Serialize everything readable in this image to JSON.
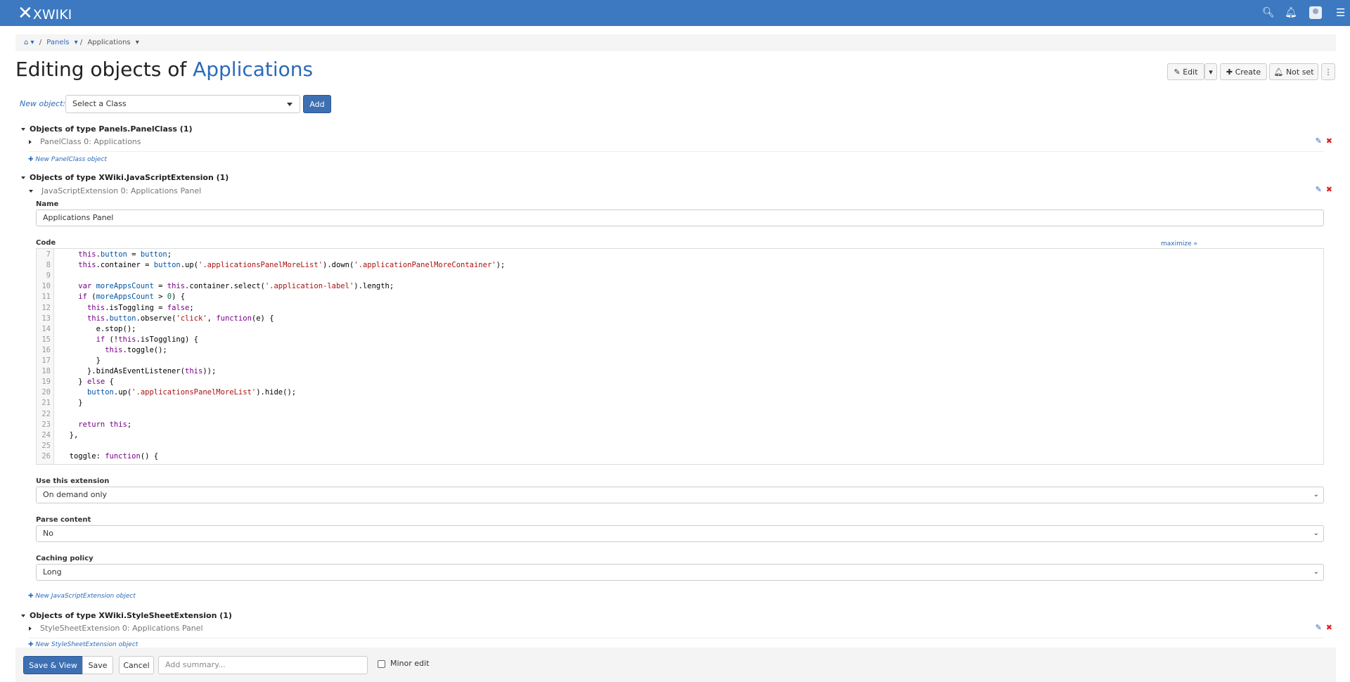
{
  "app": {
    "logo": "XWIKI"
  },
  "breadcrumb": {
    "items": [
      "Panels",
      "Applications"
    ]
  },
  "page": {
    "title_prefix": "Editing objects of",
    "title_link": "Applications"
  },
  "actions": {
    "edit": "Edit",
    "create": "Create",
    "notify": "Not set"
  },
  "new_object": {
    "label": "New object:",
    "placeholder": "Select a Class",
    "add": "Add"
  },
  "sections": [
    {
      "title": "Objects of type Panels.PanelClass (1)",
      "object": "PanelClass 0: Applications",
      "new_link": "New PanelClass object"
    },
    {
      "title": "Objects of type XWiki.JavaScriptExtension (1)",
      "object": "JavaScriptExtension 0: Applications Panel",
      "new_link": "New JavaScriptExtension object"
    },
    {
      "title": "Objects of type XWiki.StyleSheetExtension (1)",
      "object": "StyleSheetExtension 0: Applications Panel",
      "new_link": "New StyleSheetExtension object"
    }
  ],
  "form": {
    "name_label": "Name",
    "name_value": "Applications Panel",
    "code_label": "Code",
    "maximize": "maximize »",
    "use_label": "Use this extension",
    "use_value": "On demand only",
    "parse_label": "Parse content",
    "parse_value": "No",
    "cache_label": "Caching policy",
    "cache_value": "Long"
  },
  "code_lines": [
    {
      "n": "7",
      "t": "    this.button = button;"
    },
    {
      "n": "8",
      "t": "    this.container = button.up('.applicationsPanelMoreList').down('.applicationPanelMoreContainer');"
    },
    {
      "n": "9",
      "t": ""
    },
    {
      "n": "10",
      "t": "    var moreAppsCount = this.container.select('.application-label').length;"
    },
    {
      "n": "11",
      "t": "    if (moreAppsCount > 0) {"
    },
    {
      "n": "12",
      "t": "      this.isToggling = false;"
    },
    {
      "n": "13",
      "t": "      this.button.observe('click', function(e) {"
    },
    {
      "n": "14",
      "t": "        e.stop();"
    },
    {
      "n": "15",
      "t": "        if (!this.isToggling) {"
    },
    {
      "n": "16",
      "t": "          this.toggle();"
    },
    {
      "n": "17",
      "t": "        }"
    },
    {
      "n": "18",
      "t": "      }.bindAsEventListener(this));"
    },
    {
      "n": "19",
      "t": "    } else {"
    },
    {
      "n": "20",
      "t": "      button.up('.applicationsPanelMoreList').hide();"
    },
    {
      "n": "21",
      "t": "    }"
    },
    {
      "n": "22",
      "t": ""
    },
    {
      "n": "23",
      "t": "    return this;"
    },
    {
      "n": "24",
      "t": "  },"
    },
    {
      "n": "25",
      "t": ""
    },
    {
      "n": "26",
      "t": "  toggle: function() {"
    }
  ],
  "savebar": {
    "save_view": "Save & View",
    "save": "Save",
    "cancel": "Cancel",
    "summary_placeholder": "Add summary...",
    "minor": "Minor edit"
  }
}
